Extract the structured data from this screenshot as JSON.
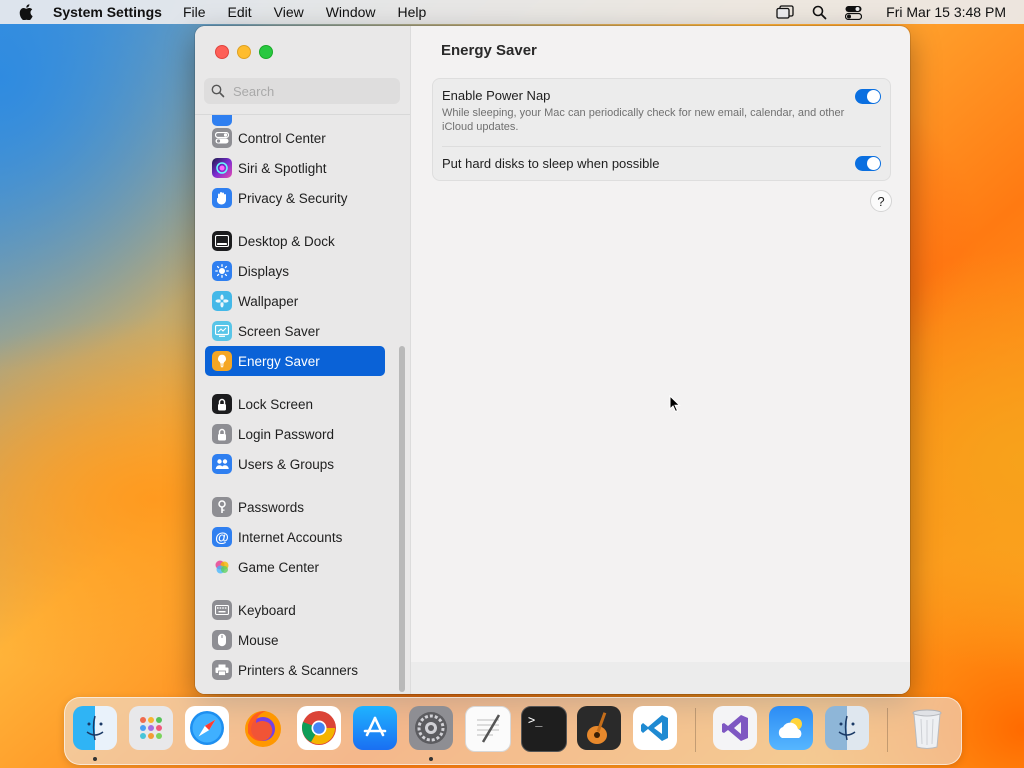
{
  "menubar": {
    "app_name": "System Settings",
    "menus": [
      "File",
      "Edit",
      "View",
      "Window",
      "Help"
    ],
    "clock": "Fri Mar 15  3:48 PM",
    "icons": [
      "screen-mirroring-icon",
      "spotlight-search-icon",
      "control-center-icon"
    ]
  },
  "window": {
    "search_placeholder": "Search",
    "content_title": "Energy Saver",
    "sidebar": {
      "items": [
        {
          "label": "Control Center",
          "icon": "control-center-icon",
          "color": "#8e8e93"
        },
        {
          "label": "Siri & Spotlight",
          "icon": "siri-icon",
          "color": "#5a2fd0"
        },
        {
          "label": "Privacy & Security",
          "icon": "hand-icon",
          "color": "#2f7ff0"
        },
        {
          "label": "Desktop & Dock",
          "icon": "dock-icon",
          "color": "#1c1c1e"
        },
        {
          "label": "Displays",
          "icon": "sun-icon",
          "color": "#2f7ff0"
        },
        {
          "label": "Wallpaper",
          "icon": "flower-icon",
          "color": "#44b8e8"
        },
        {
          "label": "Screen Saver",
          "icon": "screen-saver-icon",
          "color": "#58c5e8"
        },
        {
          "label": "Energy Saver",
          "icon": "lightbulb-icon",
          "color": "#f5a623",
          "selected": true
        },
        {
          "label": "Lock Screen",
          "icon": "lock-icon",
          "color": "#1c1c1e"
        },
        {
          "label": "Login Password",
          "icon": "padlock-icon",
          "color": "#8e8e93"
        },
        {
          "label": "Users & Groups",
          "icon": "users-icon",
          "color": "#2f7ff0"
        },
        {
          "label": "Passwords",
          "icon": "key-icon",
          "color": "#8e8e93"
        },
        {
          "label": "Internet Accounts",
          "icon": "at-sign-icon",
          "color": "#2f7ff0"
        },
        {
          "label": "Game Center",
          "icon": "game-center-icon",
          "color": "#ffffff"
        },
        {
          "label": "Keyboard",
          "icon": "keyboard-icon",
          "color": "#8e8e93"
        },
        {
          "label": "Mouse",
          "icon": "mouse-icon",
          "color": "#8e8e93"
        },
        {
          "label": "Printers & Scanners",
          "icon": "printer-icon",
          "color": "#8e8e93"
        }
      ]
    },
    "settings": {
      "power_nap": {
        "title": "Enable Power Nap",
        "description": "While sleeping, your Mac can periodically check for new email, calendar, and other iCloud updates.",
        "enabled": true
      },
      "hard_disks": {
        "title": "Put hard disks to sleep when possible",
        "enabled": true
      },
      "help_label": "?"
    }
  },
  "dock": {
    "apps": [
      {
        "name": "Finder",
        "icon": "finder-icon",
        "running": true
      },
      {
        "name": "Launchpad",
        "icon": "launchpad-icon"
      },
      {
        "name": "Safari",
        "icon": "safari-icon"
      },
      {
        "name": "Firefox",
        "icon": "firefox-icon"
      },
      {
        "name": "Chrome",
        "icon": "chrome-icon"
      },
      {
        "name": "App Store",
        "icon": "app-store-icon"
      },
      {
        "name": "System Settings",
        "icon": "system-settings-icon",
        "running": true
      },
      {
        "name": "TextEdit",
        "icon": "textedit-icon"
      },
      {
        "name": "Terminal",
        "icon": "terminal-icon"
      },
      {
        "name": "GarageBand",
        "icon": "garageband-icon"
      },
      {
        "name": "Visual Studio Code",
        "icon": "vscode-icon"
      },
      {
        "name": "Visual Studio",
        "icon": "visual-studio-icon"
      },
      {
        "name": "Weather",
        "icon": "weather-icon"
      },
      {
        "name": "Finder",
        "icon": "finder-icon"
      },
      {
        "name": "Trash",
        "icon": "trash-icon"
      }
    ]
  }
}
